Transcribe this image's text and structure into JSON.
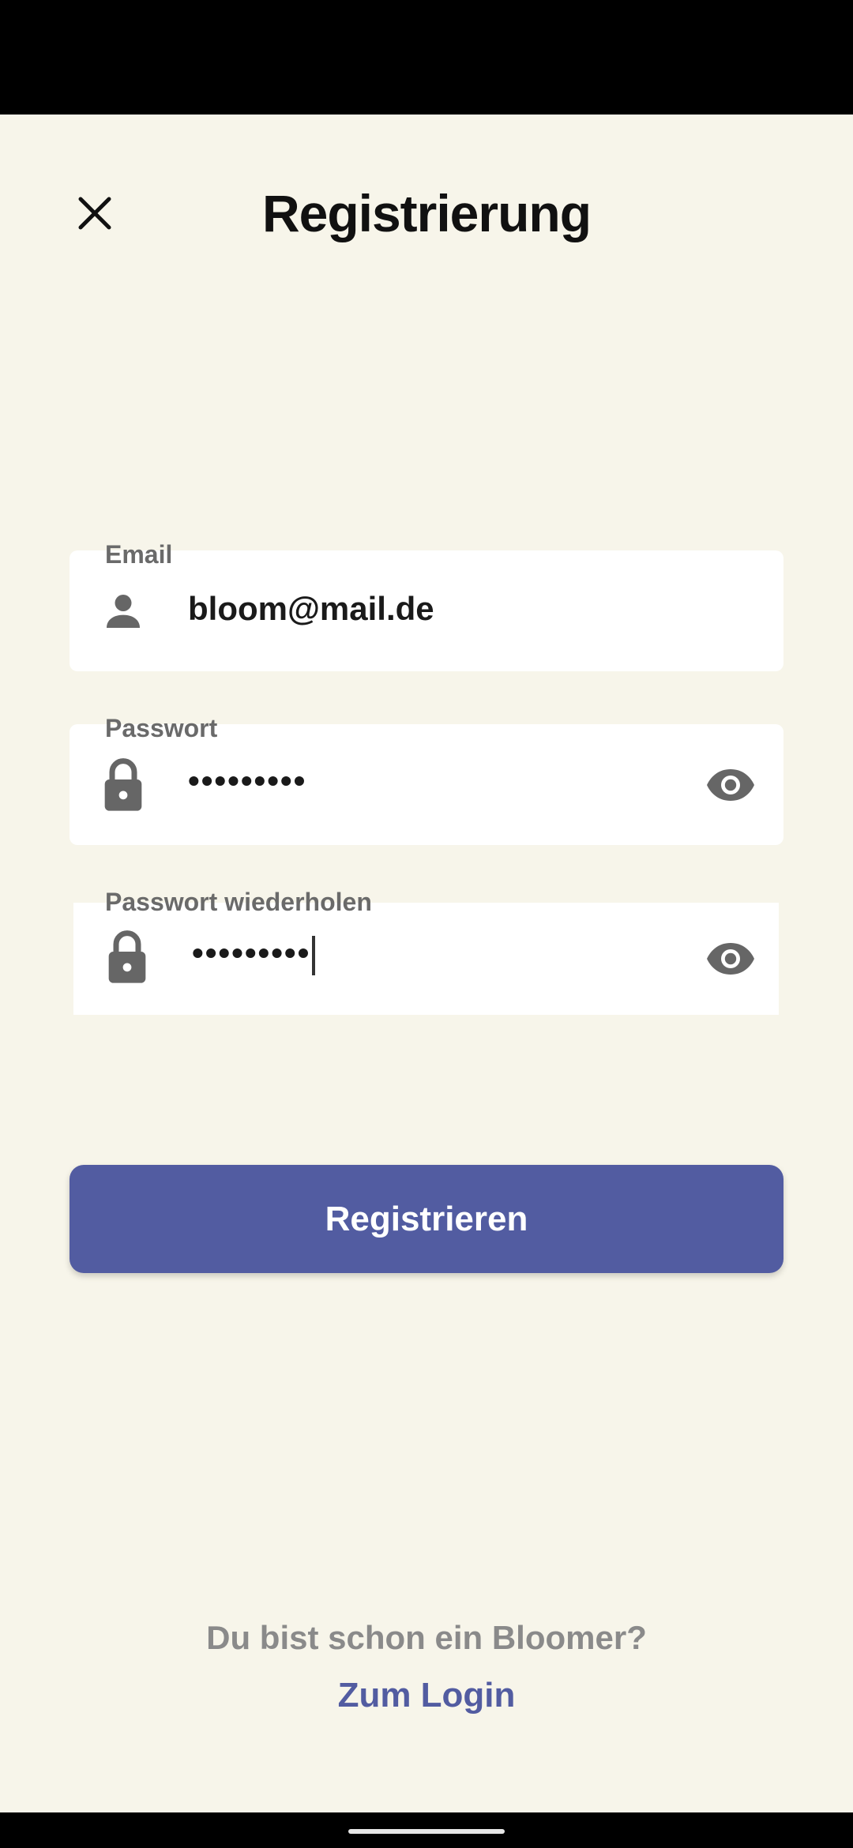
{
  "header": {
    "title": "Registrierung",
    "close_icon": "close-icon"
  },
  "form": {
    "email": {
      "label": "Email",
      "value": "bloom@mail.de",
      "icon": "person-icon"
    },
    "password": {
      "label": "Passwort",
      "value": "•••••••••",
      "icon": "lock-icon",
      "toggle_icon": "eye-icon"
    },
    "password_repeat": {
      "label": "Passwort wiederholen",
      "value": "•••••••••",
      "icon": "lock-icon",
      "toggle_icon": "eye-icon"
    },
    "submit_label": "Registrieren"
  },
  "footer": {
    "prompt": "Du bist schon ein Bloomer?",
    "login_link": "Zum Login"
  },
  "colors": {
    "background": "#f7f5ea",
    "accent": "#525ca1",
    "icon": "#666666"
  }
}
